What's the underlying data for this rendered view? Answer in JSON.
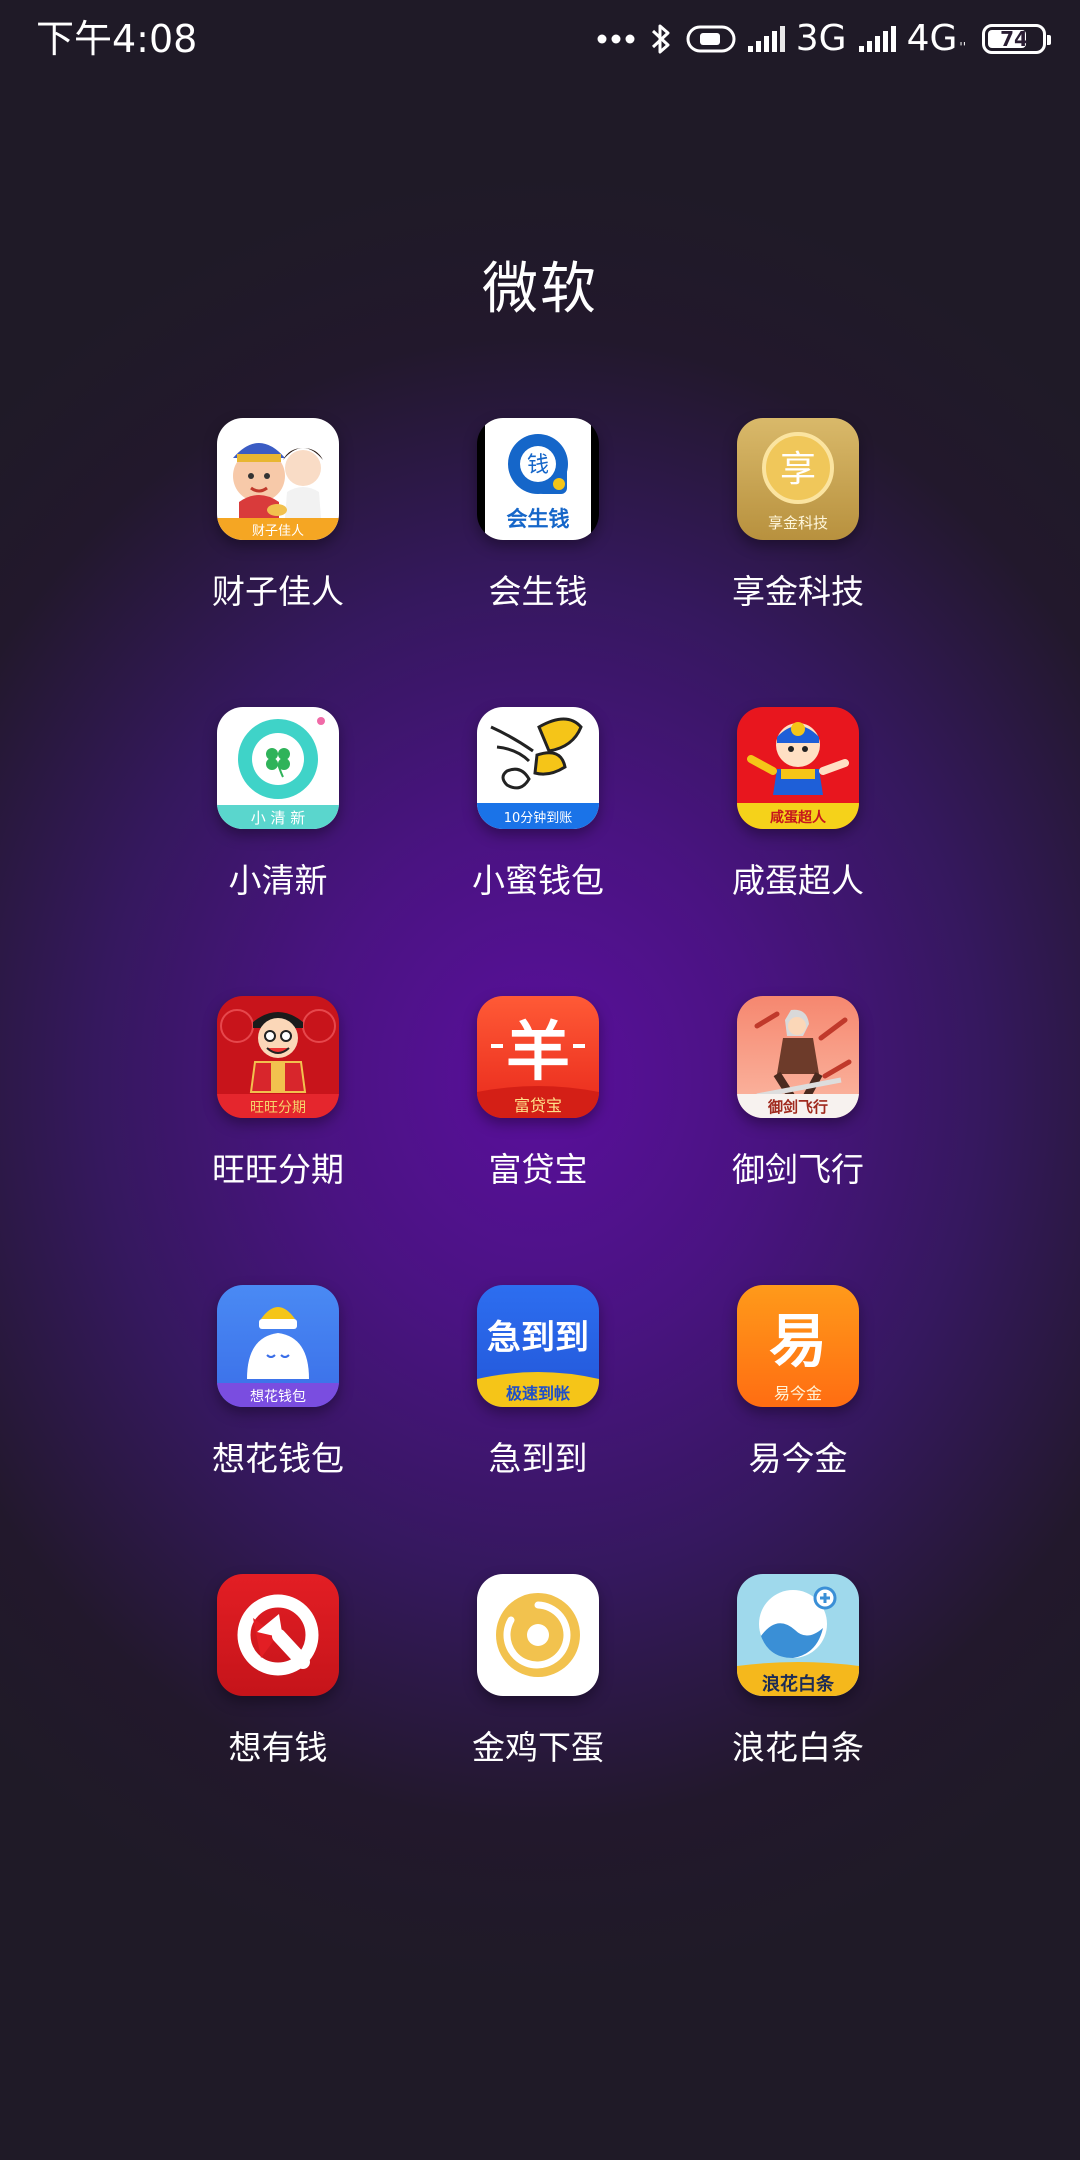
{
  "status_bar": {
    "time": "下午4:08",
    "network_1": "3G",
    "network_2": "4G",
    "network_2_sub": "''",
    "battery_level": "74",
    "battery_percent": 74,
    "icons": [
      "more-dots-icon",
      "bluetooth-icon",
      "toggle-icon",
      "signal-icon",
      "signal-icon",
      "battery-icon"
    ]
  },
  "folder": {
    "title": "微软",
    "apps": [
      {
        "label": "财子佳人",
        "icon": "caizi-jiaren-app-icon"
      },
      {
        "label": "会生钱",
        "icon": "huishengqian-app-icon",
        "icon_text": "会生钱",
        "icon_char": "钱"
      },
      {
        "label": "享金科技",
        "icon": "xiangjin-keji-app-icon",
        "icon_text": "享金科技",
        "icon_char": "享"
      },
      {
        "label": "小清新",
        "icon": "xiaoqingxin-app-icon",
        "icon_text": "小 清 新"
      },
      {
        "label": "小蜜钱包",
        "icon": "xiaomi-qianbao-app-icon",
        "icon_text": "10分钟到账"
      },
      {
        "label": "咸蛋超人",
        "icon": "xiandan-chaoren-app-icon",
        "icon_text": "咸蛋超人"
      },
      {
        "label": "旺旺分期",
        "icon": "wangwang-fenqi-app-icon",
        "icon_text": "旺旺分期"
      },
      {
        "label": "富贷宝",
        "icon": "fudaibao-app-icon",
        "icon_text": "富贷宝",
        "icon_char": "羊"
      },
      {
        "label": "御剑飞行",
        "icon": "yujian-feixing-app-icon",
        "icon_text": "御剑飞行"
      },
      {
        "label": "想花钱包",
        "icon": "xianghua-qianbao-app-icon",
        "icon_text": "想花钱包"
      },
      {
        "label": "急到到",
        "icon": "jidaodao-app-icon",
        "icon_text": "急到到",
        "icon_sub": "极速到帐"
      },
      {
        "label": "易今金",
        "icon": "yijinjin-app-icon",
        "icon_text": "易今金",
        "icon_char": "易"
      },
      {
        "label": "想有钱",
        "icon": "xiangyouqian-app-icon"
      },
      {
        "label": "金鸡下蛋",
        "icon": "jinji-xiadan-app-icon"
      },
      {
        "label": "浪花白条",
        "icon": "langhua-baitiao-app-icon",
        "icon_text": "浪花白条"
      }
    ]
  },
  "colors": {
    "background_center": "#5a0f9c",
    "background_edge": "#1f1a27",
    "text": "#ffffff"
  }
}
